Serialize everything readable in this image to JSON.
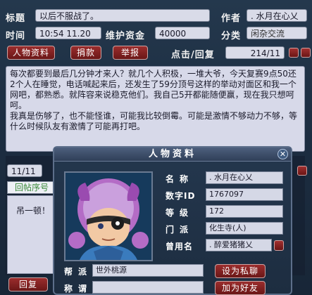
{
  "topic": {
    "title_label": "标题",
    "title_value": "以后不服战了。",
    "author_label": "作者",
    "author_value": ". 水月在心乂"
  },
  "meta": {
    "time_label": "时间",
    "time_value": "10:54 11.20",
    "fund_label": "维护资金",
    "fund_value": "40000",
    "category_label": "分类",
    "category_value": "闲杂交流"
  },
  "actions": {
    "profile": "人物资料",
    "donate": "捐款",
    "report": "举报",
    "stats_label": "点击/回复",
    "stats_value": "214/11"
  },
  "post": {
    "body": "每次都要到最后几分钟才来人？就几个人积极，一堆大爷，今天复赛9点50还2个人在睡觉，电话喊起来后，还发生了59分顶号这样的举动对面区和我一个网吧，都熟悉。就阵容来说稳克他们。我自己5开都能随便赢，现在我只想呵呵。\n我真是伤够了，也不能怪谁，可能我比较倒霉。可能是激情不够动力不够，等什么时候队友有激情了可能再打吧。"
  },
  "reply": {
    "page": "11/11",
    "floor_label": "回帖序号",
    "text": "吊一顿！",
    "back_button": "回复"
  },
  "popup": {
    "title": "人物资料",
    "close": "✕",
    "name_label": "名称",
    "name_value": ". 水月在心乂",
    "id_label": "数字ID",
    "id_value": "1767097",
    "level_label": "等级",
    "level_value": "172",
    "school_label": "门派",
    "school_value": "化生寺(人)",
    "former_label": "曾用名",
    "former_value": ". 醉爱猪猪乂",
    "gang_label": "帮派",
    "gang_value": "世外桃源",
    "title2_label": "称谓",
    "title2_value": "",
    "chat_button": "设为私聊",
    "friend_button": "加为好友"
  },
  "colors": {
    "accent": "#7a1c1c",
    "panel": "#d7d9e9",
    "background": "#1d2e42"
  }
}
